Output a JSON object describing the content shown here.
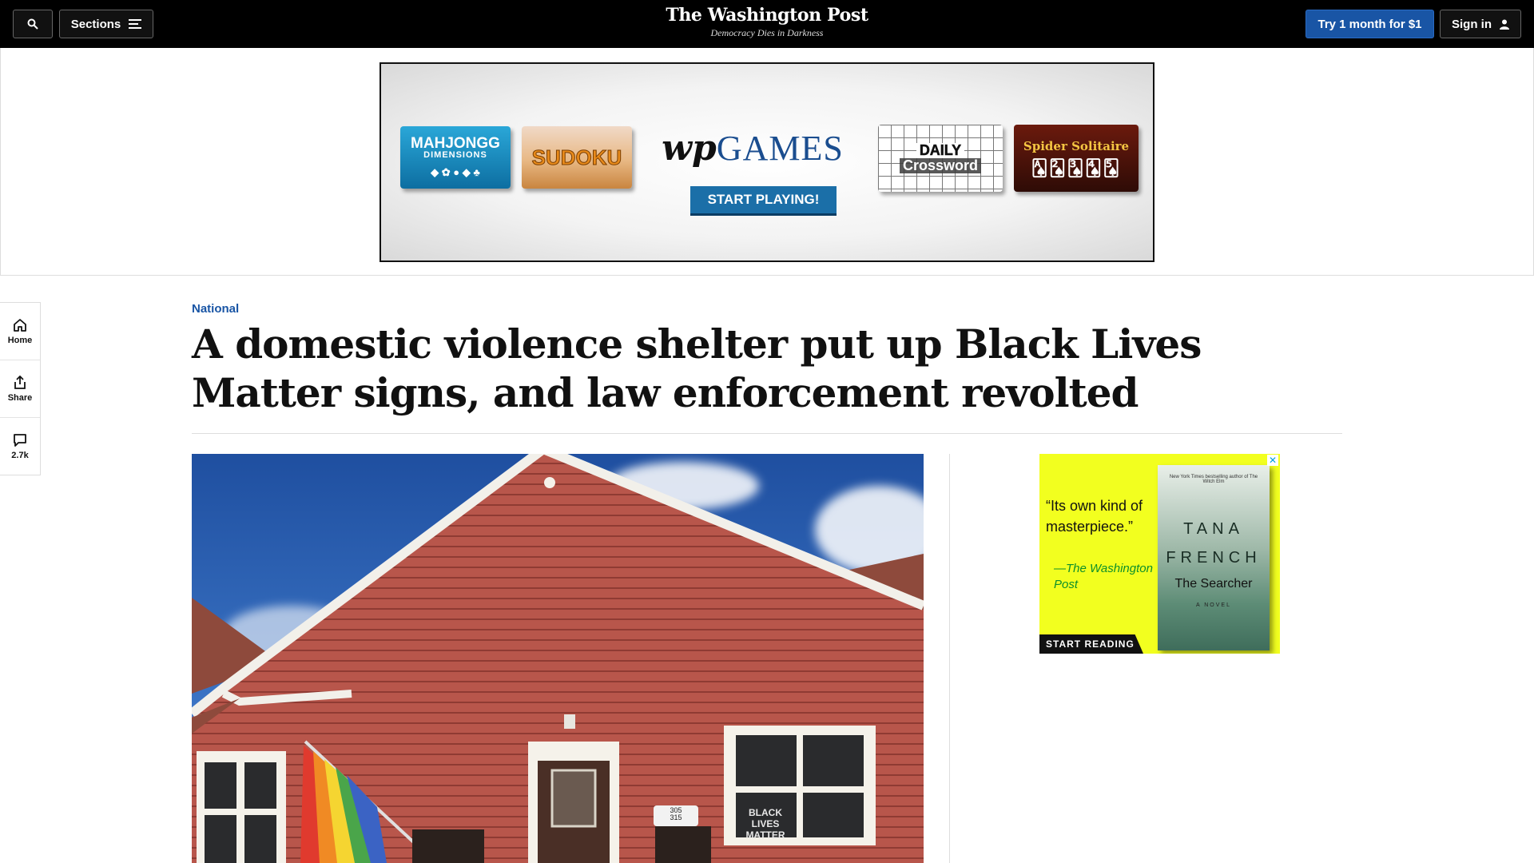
{
  "nav": {
    "sections_label": "Sections",
    "logo_text": "The Washington Post",
    "tagline": "Democracy Dies in Darkness",
    "subscribe_label": "Try 1 month for $1",
    "signin_label": "Sign in"
  },
  "top_ad": {
    "tile_mahjong_title": "MAHJONGG",
    "tile_mahjong_sub": "DIMENSIONS",
    "tile_sudoku": "SUDOKU",
    "brand_wp": "wp",
    "brand_games": "GAMES",
    "cta": "START PLAYING!",
    "tile_crossword_line1": "DAILY",
    "tile_crossword_line2": "Crossword",
    "tile_spider": "Spider Solitaire"
  },
  "rail": {
    "home_label": "Home",
    "share_label": "Share",
    "comments_count": "2.7k"
  },
  "article": {
    "kicker": "National",
    "headline": "A domestic violence shelter put up Black Lives Matter signs, and law enforcement revolted"
  },
  "photo": {
    "house_number": "305\n315",
    "sign_text": "BLACK LIVES MATTER"
  },
  "side_ad": {
    "quote": "“Its own kind of masterpiece.”",
    "attribution": "—The Washington Post",
    "cta": "START READING",
    "book_blurb": "New York Times bestselling author of The Witch Elm",
    "book_author": "TANA FRENCH",
    "book_title": "The Searcher",
    "book_subtitle": "A NOVEL",
    "close_label": "✕"
  },
  "colors": {
    "nav_bg": "#000000",
    "brand_blue": "#1955a5",
    "ad_yellow": "#f2ff1f",
    "siding_red": "#b8564b"
  }
}
